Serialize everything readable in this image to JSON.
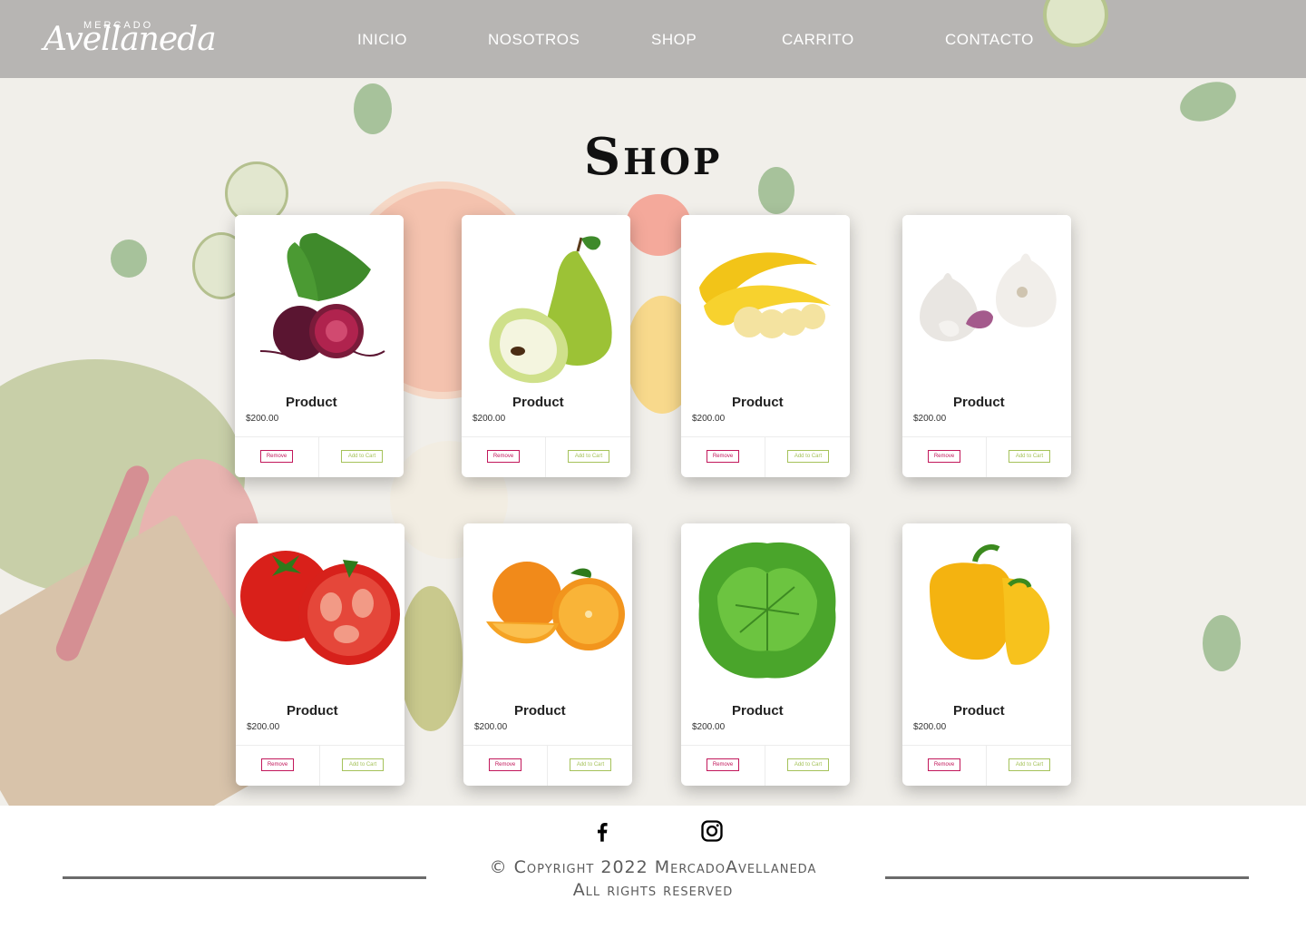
{
  "brand": {
    "small": "MERCADO",
    "main": "Avellaneda"
  },
  "nav": {
    "inicio": "INICIO",
    "nosotros": "NOSOTROS",
    "shop": "SHOP",
    "carrito": "CARRITO",
    "contacto": "CONTACTO"
  },
  "page": {
    "title": "Shop"
  },
  "products": [
    {
      "name": "Product",
      "price": "$200.00",
      "remove": "Remove",
      "add": "Add to Cart",
      "icon": "beetroot-image"
    },
    {
      "name": "Product",
      "price": "$200.00",
      "remove": "Remove",
      "add": "Add to Cart",
      "icon": "pear-image"
    },
    {
      "name": "Product",
      "price": "$200.00",
      "remove": "Remove",
      "add": "Add to Cart",
      "icon": "banana-image"
    },
    {
      "name": "Product",
      "price": "$200.00",
      "remove": "Remove",
      "add": "Add to Cart",
      "icon": "garlic-image"
    },
    {
      "name": "Product",
      "price": "$200.00",
      "remove": "Remove",
      "add": "Add to Cart",
      "icon": "tomato-image"
    },
    {
      "name": "Product",
      "price": "$200.00",
      "remove": "Remove",
      "add": "Add to Cart",
      "icon": "orange-image"
    },
    {
      "name": "Product",
      "price": "$200.00",
      "remove": "Remove",
      "add": "Add to Cart",
      "icon": "lettuce-image"
    },
    {
      "name": "Product",
      "price": "$200.00",
      "remove": "Remove",
      "add": "Add to Cart",
      "icon": "yellow-pepper-image"
    }
  ],
  "footer": {
    "copyright": "© Copyright 2022 MercadoAvellaneda",
    "rights": "All rights reserved",
    "icons": [
      "facebook-icon",
      "instagram-icon"
    ]
  },
  "colors": {
    "header": "#b7b5b3",
    "remove": "#c2185b",
    "add": "#a5c25a",
    "footer_line": "#6b6b6b"
  }
}
